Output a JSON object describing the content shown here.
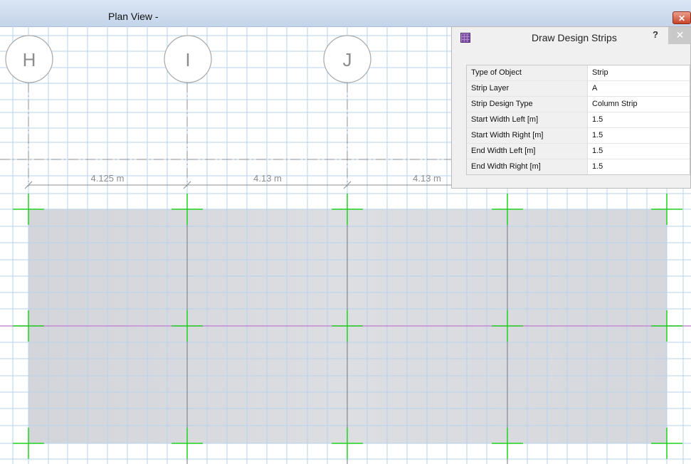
{
  "window": {
    "title": "Plan View -",
    "close_glyph": "✕"
  },
  "grid": {
    "bubbles": [
      "H",
      "I",
      "J"
    ],
    "dimensions": [
      "4.125 m",
      "4.13 m",
      "4.13 m"
    ],
    "colors": {
      "gridline": "#b7d3ee",
      "slab": "#d4d6db",
      "column_mark": "#1fd21f",
      "strip_line": "#c78ad6",
      "bubble": "#a8a8a8"
    }
  },
  "dialog": {
    "title": "Draw Design Strips",
    "help_glyph": "?",
    "close_glyph": "✕",
    "icon": "grid-icon",
    "properties": [
      {
        "label": "Type of Object",
        "value": "Strip"
      },
      {
        "label": "Strip Layer",
        "value": "A"
      },
      {
        "label": "Strip Design Type",
        "value": "Column Strip"
      },
      {
        "label": "Start Width Left  [m]",
        "value": "1.5"
      },
      {
        "label": "Start Width Right  [m]",
        "value": "1.5"
      },
      {
        "label": "End Width Left  [m]",
        "value": "1.5"
      },
      {
        "label": "End Width Right  [m]",
        "value": "1.5"
      }
    ]
  }
}
